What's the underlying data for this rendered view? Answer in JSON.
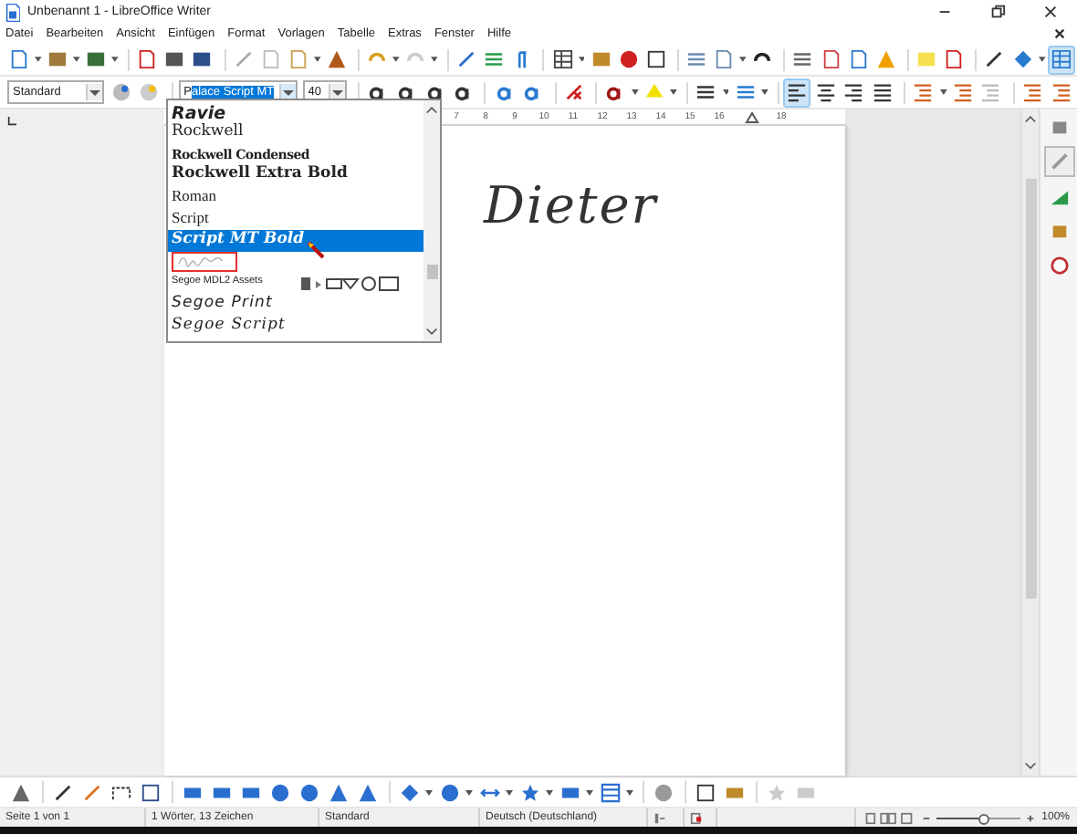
{
  "window": {
    "title": "Unbenannt 1 - LibreOffice Writer"
  },
  "menu": [
    "Datei",
    "Bearbeiten",
    "Ansicht",
    "Einfügen",
    "Format",
    "Vorlagen",
    "Tabelle",
    "Extras",
    "Fenster",
    "Hilfe"
  ],
  "formatting": {
    "paragraph_style": "Standard",
    "font_name_prefix": "P",
    "font_name_selected": "alace Script MT",
    "font_size": "40",
    "align_buttons": [
      {
        "selected": true
      },
      {
        "selected": false
      },
      {
        "selected": false
      },
      {
        "selected": false
      }
    ]
  },
  "font_list": [
    {
      "kind": "heavy",
      "label": "Ravie",
      "selected": false
    },
    {
      "kind": "slab",
      "label": "Rockwell",
      "selected": false
    },
    {
      "kind": "condensed",
      "label": "Rockwell Condensed",
      "selected": false
    },
    {
      "kind": "black",
      "label": "Rockwell Extra Bold",
      "selected": false
    },
    {
      "kind": "plain",
      "label": "Roman",
      "selected": false
    },
    {
      "kind": "plain",
      "label": "Script",
      "selected": false
    },
    {
      "kind": "scriptbold",
      "label": "Script MT Bold",
      "selected": true
    },
    {
      "kind": "unreadable",
      "selected": false,
      "marked": true
    },
    {
      "kind": "symbol",
      "label": "Segoe MDL2 Assets",
      "selected": false
    },
    {
      "kind": "print",
      "label": "Segoe Print",
      "selected": false
    },
    {
      "kind": "script",
      "label": "Segoe Script",
      "selected": false
    }
  ],
  "ruler": {
    "numbers": [
      "7",
      "8",
      "9",
      "10",
      "11",
      "12",
      "13",
      "14",
      "15",
      "16",
      "18"
    ]
  },
  "document": {
    "text": "Dieter"
  },
  "status_bar": {
    "page": "Seite 1 von 1",
    "count": "1 Wörter, 13 Zeichen",
    "style": "Standard",
    "language": "Deutsch (Deutschland)",
    "zoom": "100%"
  },
  "zoom_slider": {
    "level": 0.5
  }
}
